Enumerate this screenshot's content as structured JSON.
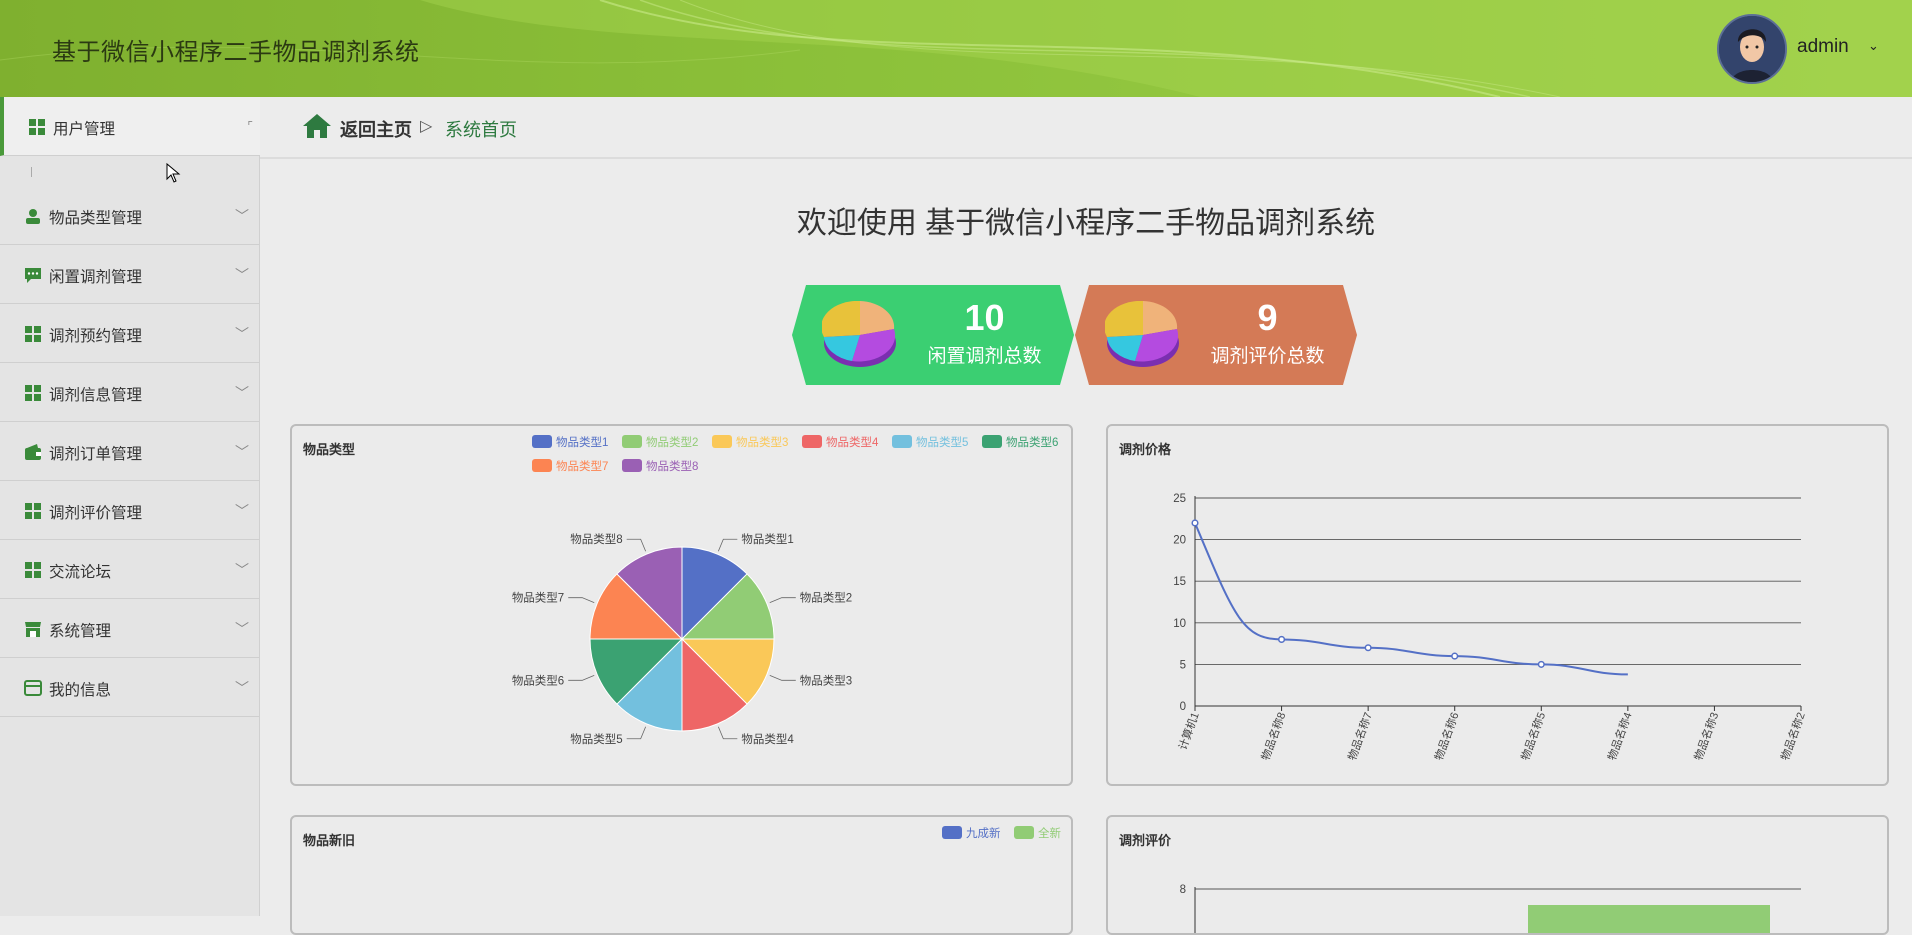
{
  "header": {
    "title": "基于微信小程序二手物品调剂系统",
    "user": "admin",
    "caret": "⌄"
  },
  "sidebar": {
    "items": [
      {
        "label": "用户管理",
        "icon": "grid-icon"
      },
      {
        "label": "物品类型管理",
        "icon": "user-icon"
      },
      {
        "label": "闲置调剂管理",
        "icon": "chat-icon"
      },
      {
        "label": "调剂预约管理",
        "icon": "grid-icon"
      },
      {
        "label": "调剂信息管理",
        "icon": "grid-icon"
      },
      {
        "label": "调剂订单管理",
        "icon": "wallet-icon"
      },
      {
        "label": "调剂评价管理",
        "icon": "grid-icon"
      },
      {
        "label": "交流论坛",
        "icon": "grid-icon"
      },
      {
        "label": "系统管理",
        "icon": "store-icon"
      },
      {
        "label": "我的信息",
        "icon": "card-icon"
      }
    ]
  },
  "breadcrumb": {
    "back": "返回主页",
    "separator": "▷",
    "current": "系统首页"
  },
  "welcome": "欢迎使用 基于微信小程序二手物品调剂系统",
  "stats": [
    {
      "value": "10",
      "label": "闲置调剂总数",
      "color": "#3bcf72"
    },
    {
      "value": "9",
      "label": "调剂评价总数",
      "color": "#d47a56"
    }
  ],
  "panels": {
    "type_title": "物品类型",
    "price_title": "调剂价格",
    "condition_title": "物品新旧",
    "review_title": "调剂评价"
  },
  "chart_data": [
    {
      "type": "pie",
      "title": "物品类型",
      "labels": [
        "物品类型1",
        "物品类型2",
        "物品类型3",
        "物品类型4",
        "物品类型5",
        "物品类型6",
        "物品类型7",
        "物品类型8"
      ],
      "values": [
        1,
        1,
        1,
        1,
        1,
        1,
        1,
        1
      ],
      "colors": [
        "#5470c6",
        "#91cc75",
        "#fac858",
        "#ee6666",
        "#73c0de",
        "#3ba272",
        "#fc8452",
        "#9a60b4"
      ],
      "legend": "top-right"
    },
    {
      "type": "line",
      "title": "调剂价格",
      "categories": [
        "计算机1",
        "物品名称8",
        "物品名称7",
        "物品名称6",
        "物品名称5",
        "物品名称4",
        "物品名称3",
        "物品名称2"
      ],
      "values": [
        22,
        8,
        7,
        6,
        5,
        3.8
      ],
      "ylim": [
        0,
        25
      ],
      "yticks": [
        0,
        5,
        10,
        15,
        20,
        25
      ],
      "color": "#5470c6",
      "grid": true
    },
    {
      "type": "pie",
      "title": "物品新旧",
      "labels": [
        "九成新",
        "全新"
      ],
      "colors": [
        "#5470c6",
        "#91cc75"
      ],
      "legend": "top-right"
    },
    {
      "type": "bar",
      "title": "调剂评价",
      "yticks": [
        8
      ],
      "color": "#91cc75"
    }
  ]
}
